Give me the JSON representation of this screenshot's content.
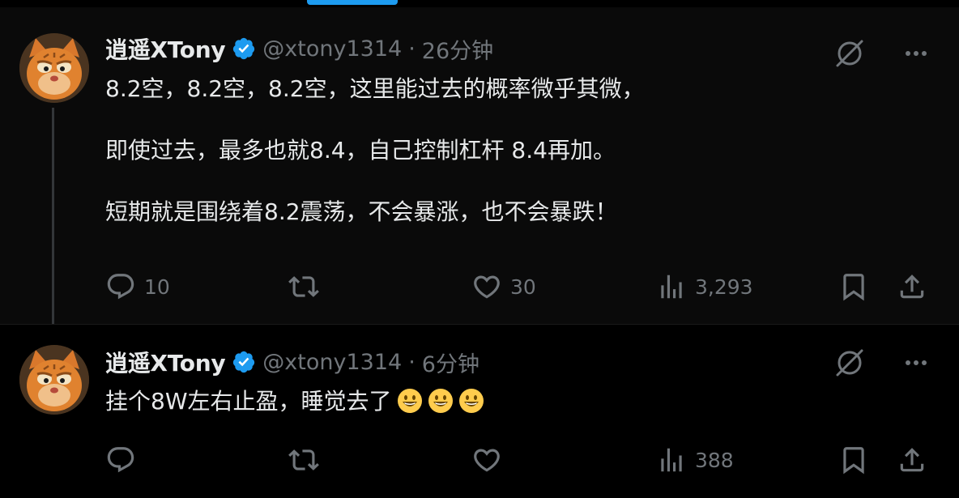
{
  "tweets": [
    {
      "author": {
        "name": "逍遥XTony",
        "handle": "@xtony1314",
        "verified": true
      },
      "separator": "·",
      "time": "26分钟",
      "paragraphs": [
        "8.2空，8.2空，8.2空，这里能过去的概率微乎其微，",
        "即使过去，最多也就8.4，自己控制杠杆 8.4再加。",
        "短期就是围绕着8.2震荡，不会暴涨，也不会暴跌！"
      ],
      "stats": {
        "replies": "10",
        "retweets": "",
        "likes": "30",
        "views": "3,293"
      }
    },
    {
      "author": {
        "name": "逍遥XTony",
        "handle": "@xtony1314",
        "verified": true
      },
      "separator": "·",
      "time": "6分钟",
      "text": "挂个8W左右止盈，睡觉去了",
      "emojis": [
        "grinning-face",
        "grinning-face",
        "grinning-face"
      ],
      "stats": {
        "replies": "",
        "retweets": "",
        "likes": "",
        "views": "388"
      }
    }
  ],
  "icons": {
    "top": [
      "grok-icon",
      "more-icon"
    ],
    "actions": [
      "reply-icon",
      "retweet-icon",
      "like-icon",
      "views-icon",
      "bookmark-icon",
      "share-icon"
    ]
  },
  "colors": {
    "background": "#000000",
    "text": "#e7e9ea",
    "muted": "#71767b",
    "verified": "#1d9bf0",
    "accent": "#1d9bf0",
    "thread_line": "#333639"
  }
}
